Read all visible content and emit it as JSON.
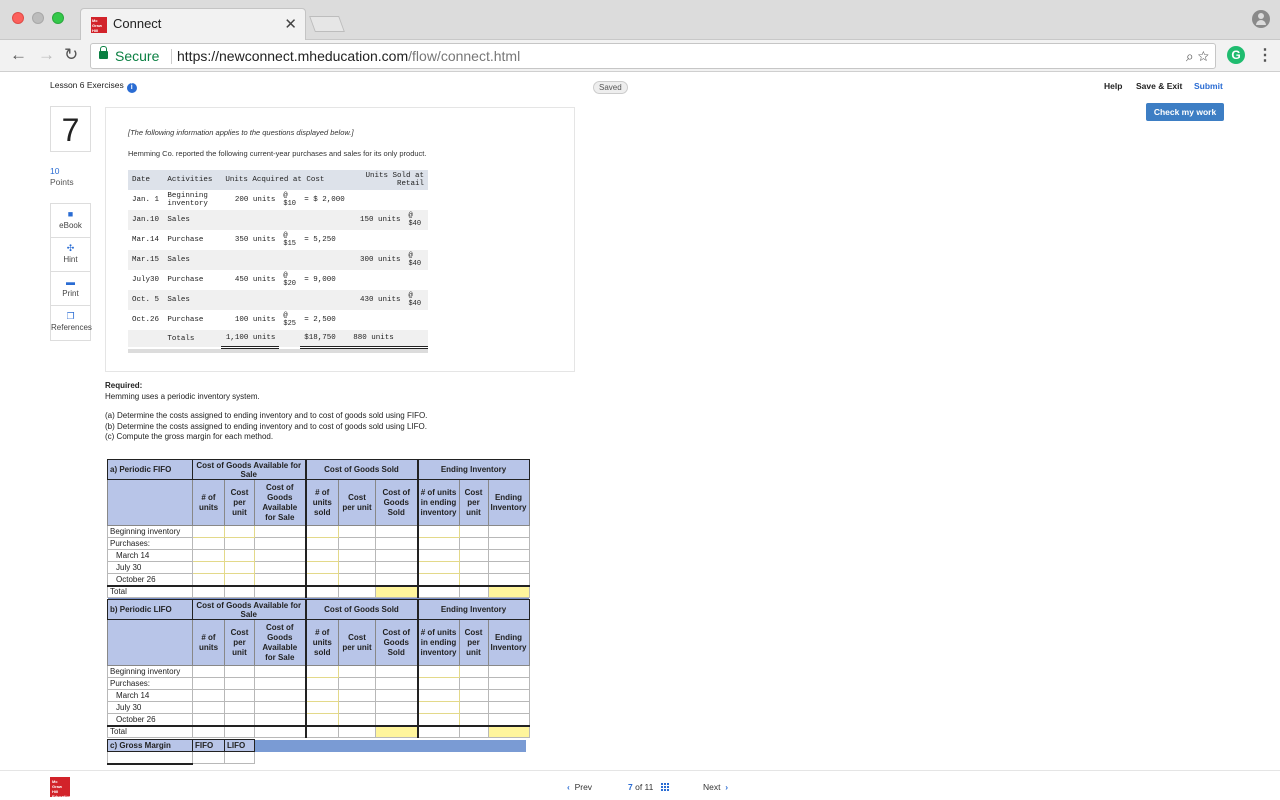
{
  "browser": {
    "tab_title": "Connect",
    "tab_close": "✕",
    "secure_label": "Secure",
    "url_host": "https://newconnect.mheducation.com",
    "url_path": "/flow/connect.html",
    "logo_text": "Mc Graw Hill Education"
  },
  "header": {
    "lesson": "Lesson 6 Exercises",
    "saved": "Saved",
    "help": "Help",
    "save_exit": "Save & Exit",
    "submit": "Submit",
    "check": "Check my work"
  },
  "question": {
    "number": "7",
    "points_value": "10",
    "points_label": "Points"
  },
  "tools": [
    {
      "label": "eBook",
      "icon": "book-icon"
    },
    {
      "label": "Hint",
      "icon": "hint-icon"
    },
    {
      "label": "Print",
      "icon": "print-icon"
    },
    {
      "label": "References",
      "icon": "references-icon"
    }
  ],
  "card": {
    "intro": "[The following information applies to the questions displayed below.]",
    "line": "Hemming Co. reported the following current-year purchases and sales for its only product.",
    "headers": [
      "Date",
      "Activities",
      "Units Acquired at Cost",
      "Units Sold at Retail"
    ],
    "rows": [
      {
        "date": "Jan. 1",
        "activity": "Beginning inventory",
        "units": "200 units",
        "cost": "$10",
        "eq": "= $ 2,000",
        "sold": "",
        "retail": ""
      },
      {
        "date": "Jan.10",
        "activity": "Sales",
        "units": "",
        "cost": "",
        "eq": "",
        "sold": "150 units",
        "retail": "$40"
      },
      {
        "date": "Mar.14",
        "activity": "Purchase",
        "units": "350 units",
        "cost": "$15",
        "eq": "=   5,250",
        "sold": "",
        "retail": ""
      },
      {
        "date": "Mar.15",
        "activity": "Sales",
        "units": "",
        "cost": "",
        "eq": "",
        "sold": "300 units",
        "retail": "$40"
      },
      {
        "date": "July30",
        "activity": "Purchase",
        "units": "450 units",
        "cost": "$20",
        "eq": "=   9,000",
        "sold": "",
        "retail": ""
      },
      {
        "date": "Oct. 5",
        "activity": "Sales",
        "units": "",
        "cost": "",
        "eq": "",
        "sold": "430 units",
        "retail": "$40"
      },
      {
        "date": "Oct.26",
        "activity": "Purchase",
        "units": "100 units",
        "cost": "$25",
        "eq": "=   2,500",
        "sold": "",
        "retail": ""
      }
    ],
    "totals": {
      "label": "Totals",
      "units": "1,100 units",
      "amount": "$18,750",
      "sold": "880 units"
    }
  },
  "required": {
    "title": "Required:",
    "line": "Hemming uses a periodic inventory system.",
    "a": "(a) Determine the costs assigned to ending inventory and to cost of goods sold using FIFO.",
    "b": "(b) Determine the costs assigned to ending inventory and to cost of goods sold using LIFO.",
    "c": "(c) Compute the gross margin for each method."
  },
  "worksheet": {
    "fifo_title": "a) Periodic FIFO",
    "lifo_title": "b) Periodic LIFO",
    "group1": "Cost of Goods Available for Sale",
    "group2": "Cost of Goods Sold",
    "group3": "Ending Inventory",
    "cols": [
      "# of units",
      "Cost per unit",
      "Cost of Goods Available for Sale",
      "# of units sold",
      "Cost per unit",
      "Cost of Goods Sold",
      "# of units in ending inventory",
      "Cost per unit",
      "Ending Inventory"
    ],
    "rows": [
      "Beginning inventory",
      "Purchases:",
      "March 14",
      "July 30",
      "October 26",
      "Total"
    ]
  },
  "gross_margin": {
    "label": "c) Gross Margin",
    "fifo": "FIFO",
    "lifo": "LIFO"
  },
  "footer": {
    "prev": "Prev",
    "current": "7",
    "of": "of 11",
    "next": "Next"
  }
}
